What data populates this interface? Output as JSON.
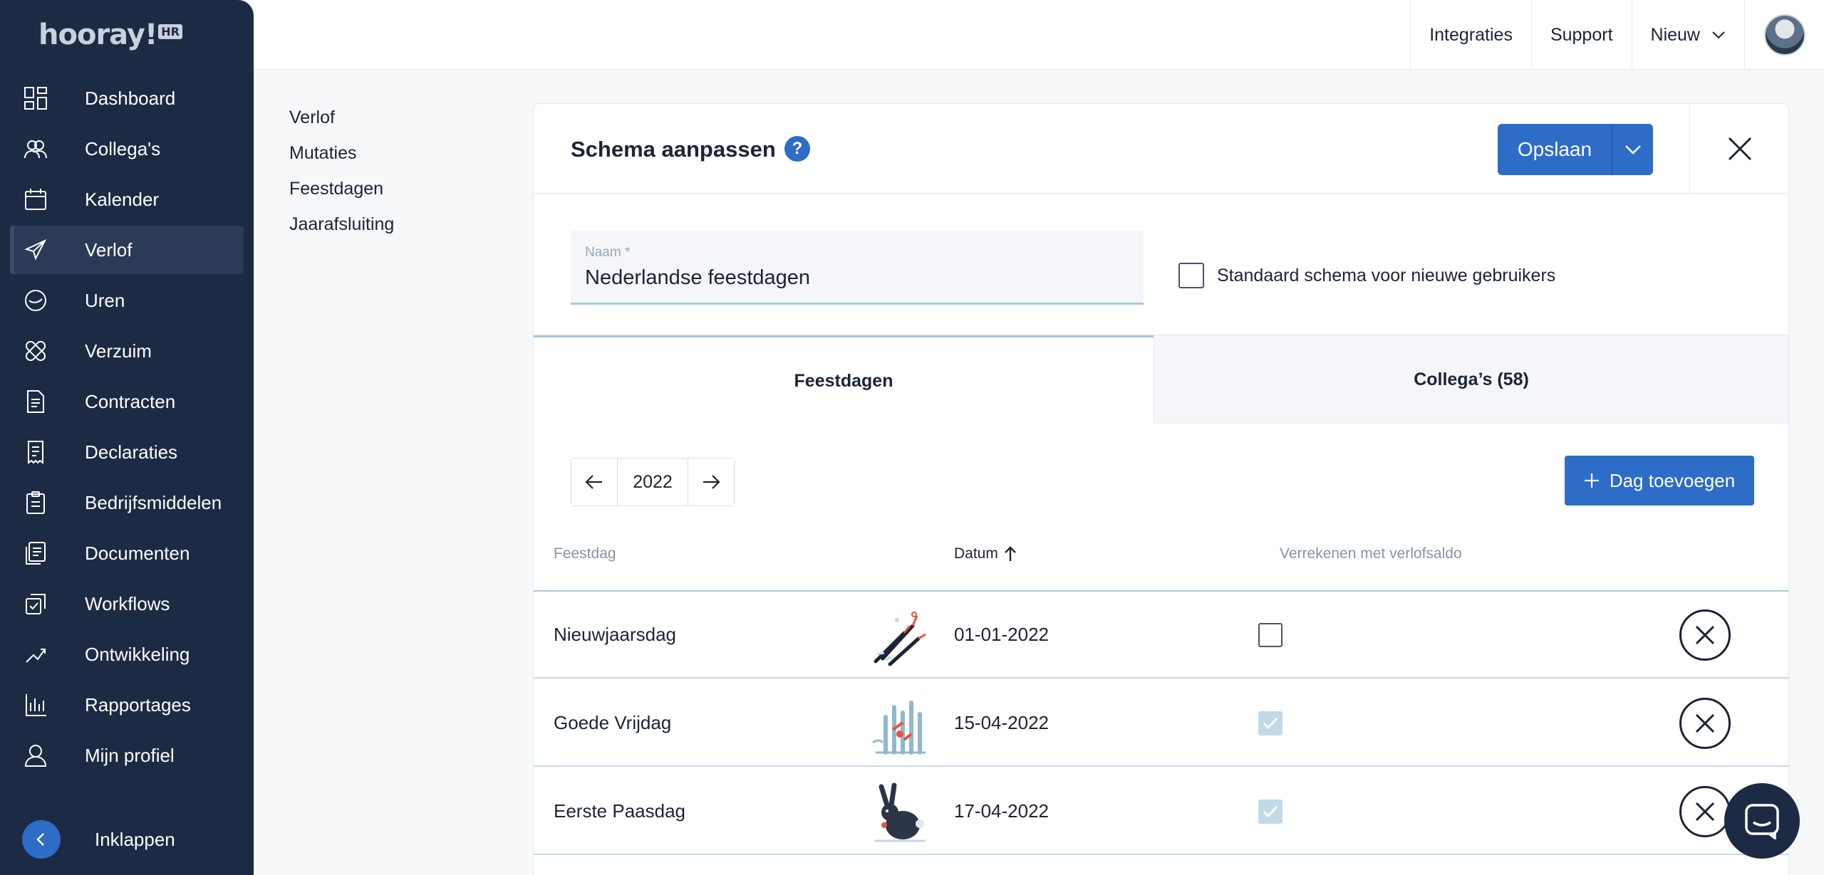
{
  "brand": {
    "logo_text": "hooray!",
    "logo_badge": "HR"
  },
  "sidebar": {
    "items": [
      {
        "label": "Dashboard",
        "icon": "dashboard-icon"
      },
      {
        "label": "Collega's",
        "icon": "people-icon"
      },
      {
        "label": "Kalender",
        "icon": "calendar-icon"
      },
      {
        "label": "Verlof",
        "icon": "airplane-icon",
        "active": true
      },
      {
        "label": "Uren",
        "icon": "clock-icon"
      },
      {
        "label": "Verzuim",
        "icon": "bandage-icon"
      },
      {
        "label": "Contracten",
        "icon": "document-icon"
      },
      {
        "label": "Declaraties",
        "icon": "receipt-icon"
      },
      {
        "label": "Bedrijfsmiddelen",
        "icon": "clipboard-icon"
      },
      {
        "label": "Documenten",
        "icon": "documents-icon"
      },
      {
        "label": "Workflows",
        "icon": "workflow-icon"
      },
      {
        "label": "Ontwikkeling",
        "icon": "growth-icon"
      },
      {
        "label": "Rapportages",
        "icon": "bar-chart-icon"
      },
      {
        "label": "Mijn profiel",
        "icon": "user-icon"
      }
    ],
    "collapse_label": "Inklappen"
  },
  "topbar": {
    "integraties": "Integraties",
    "support": "Support",
    "nieuw": "Nieuw"
  },
  "subnav": {
    "items": [
      "Verlof",
      "Mutaties",
      "Feestdagen",
      "Jaarafsluiting"
    ]
  },
  "panel": {
    "title": "Schema aanpassen",
    "help": "?",
    "save_label": "Opslaan",
    "name_label": "Naam *",
    "name_value": "Nederlandse feestdagen",
    "default_label": "Standaard schema voor nieuwe gebruikers",
    "default_checked": false,
    "tabs": [
      {
        "label": "Feestdagen",
        "active": true
      },
      {
        "label": "Collega’s (58)",
        "active": false
      }
    ],
    "year": "2022",
    "add_day_label": "Dag toevoegen",
    "columns": {
      "feestdag": "Feestdag",
      "datum": "Datum",
      "verrekenen": "Verrekenen met verlofsaldo"
    },
    "rows": [
      {
        "name": "Nieuwjaarsdag",
        "date": "01-01-2022",
        "verrekenen": false,
        "illustration": "fireworks-illustration"
      },
      {
        "name": "Goede Vrijdag",
        "date": "15-04-2022",
        "verrekenen": true,
        "illustration": "flowers-illustration"
      },
      {
        "name": "Eerste Paasdag",
        "date": "17-04-2022",
        "verrekenen": true,
        "illustration": "rabbit-illustration"
      }
    ]
  },
  "colors": {
    "sidebar_bg": "#1d2a44",
    "primary": "#2d6cc7",
    "accent_line": "#a9c7dc"
  }
}
